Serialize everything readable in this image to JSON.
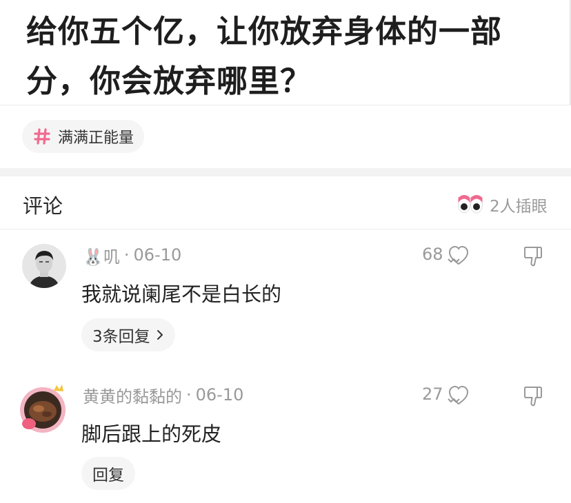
{
  "question": {
    "title": "给你五个亿，让你放弃身体的一部分，你会放弃哪里？"
  },
  "topic": {
    "label": "满满正能量",
    "hash_icon": "hash-icon",
    "accent_color": "#f06a8e"
  },
  "comments_section": {
    "title": "评论",
    "watchers": "2人插眼",
    "eyes_icon": "eyes-icon"
  },
  "comments": [
    {
      "author": "🐰叽",
      "date": "06-10",
      "text": "我就说阑尾不是白长的",
      "likes": "68",
      "reply_label": "3条回复"
    },
    {
      "author": "黄黄的黏黏的",
      "date": "06-10",
      "text": "脚后跟上的死皮",
      "likes": "27",
      "reply_label": "回复"
    }
  ],
  "separator": "·"
}
